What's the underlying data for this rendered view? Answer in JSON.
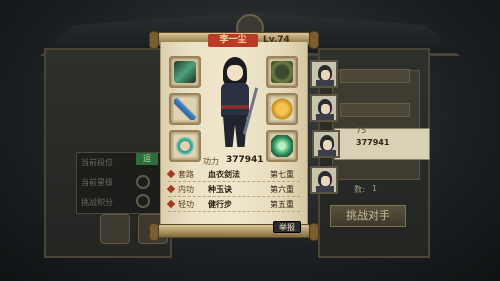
{
  "popup": {
    "player_name": "李一尘",
    "level": "Lv.74",
    "power_label": "功力",
    "power_value": "377941",
    "report_label": "举报"
  },
  "equipment": {
    "left": [
      "green-blade-weapon-icon",
      "blue-dagger-icon",
      "jade-bracelet-icon"
    ],
    "right": [
      "beast-mask-helmet-icon",
      "golden-armor-icon",
      "green-orb-accessory-icon"
    ]
  },
  "skills": [
    {
      "category": "套路",
      "name": "血衣剑法",
      "rank": "第七重"
    },
    {
      "category": "内功",
      "name": "种玉诀",
      "rank": "第六重"
    },
    {
      "category": "轻功",
      "name": "健行步",
      "rank": "第五重"
    }
  ],
  "background": {
    "rank_rows": [
      "当前段位",
      "当前星级",
      "挑战积分"
    ],
    "rank_highlight": "运",
    "opponents": {
      "selected_stat_top": "75",
      "selected_stat_power": "377941",
      "count_label": "数:",
      "count_value": "1"
    },
    "challenge_button": "挑战对手"
  },
  "colors": {
    "name_plate": "#b93a26",
    "paper": "#efe6cc",
    "scroll_rod": "#a88f5d"
  }
}
